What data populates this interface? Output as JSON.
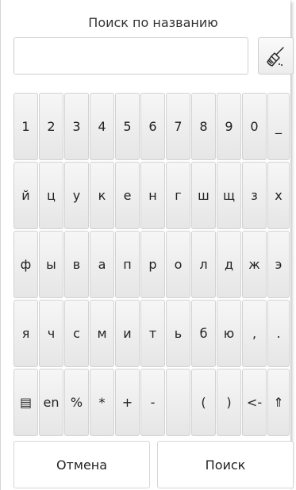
{
  "dialog": {
    "title": "Поиск по названию",
    "search": {
      "value": "",
      "placeholder": ""
    },
    "clear_icon": "broom-icon"
  },
  "keyboard": {
    "rows": [
      [
        "1",
        "2",
        "3",
        "4",
        "5",
        "6",
        "7",
        "8",
        "9",
        "0",
        "_"
      ],
      [
        "й",
        "ц",
        "у",
        "к",
        "е",
        "н",
        "г",
        "ш",
        "щ",
        "з",
        "х"
      ],
      [
        "ф",
        "ы",
        "в",
        "а",
        "п",
        "р",
        "о",
        "л",
        "д",
        "ж",
        "э"
      ],
      [
        "я",
        "ч",
        "с",
        "м",
        "и",
        "т",
        "ь",
        "б",
        "ю",
        ",",
        "."
      ],
      [
        "▤",
        "en",
        "%",
        "*",
        "+",
        "-",
        " ",
        "(",
        ")",
        "<-",
        "⇑"
      ]
    ],
    "key_names": [
      [
        "key-1",
        "key-2",
        "key-3",
        "key-4",
        "key-5",
        "key-6",
        "key-7",
        "key-8",
        "key-9",
        "key-0",
        "key-underscore"
      ],
      [
        "key-й",
        "key-ц",
        "key-у",
        "key-к",
        "key-е",
        "key-н",
        "key-г",
        "key-ш",
        "key-щ",
        "key-з",
        "key-х"
      ],
      [
        "key-ф",
        "key-ы",
        "key-в",
        "key-а",
        "key-п",
        "key-р",
        "key-о",
        "key-л",
        "key-д",
        "key-ж",
        "key-э"
      ],
      [
        "key-я",
        "key-ч",
        "key-с",
        "key-м",
        "key-и",
        "key-т",
        "key-ь",
        "key-б",
        "key-ю",
        "key-comma",
        "key-period"
      ],
      [
        "key-layout-menu",
        "key-language-en",
        "key-percent",
        "key-asterisk",
        "key-plus",
        "key-minus",
        "key-space",
        "key-paren-open",
        "key-paren-close",
        "key-backspace",
        "key-shift"
      ]
    ]
  },
  "buttons": {
    "cancel": "Отмена",
    "search": "Поиск"
  }
}
